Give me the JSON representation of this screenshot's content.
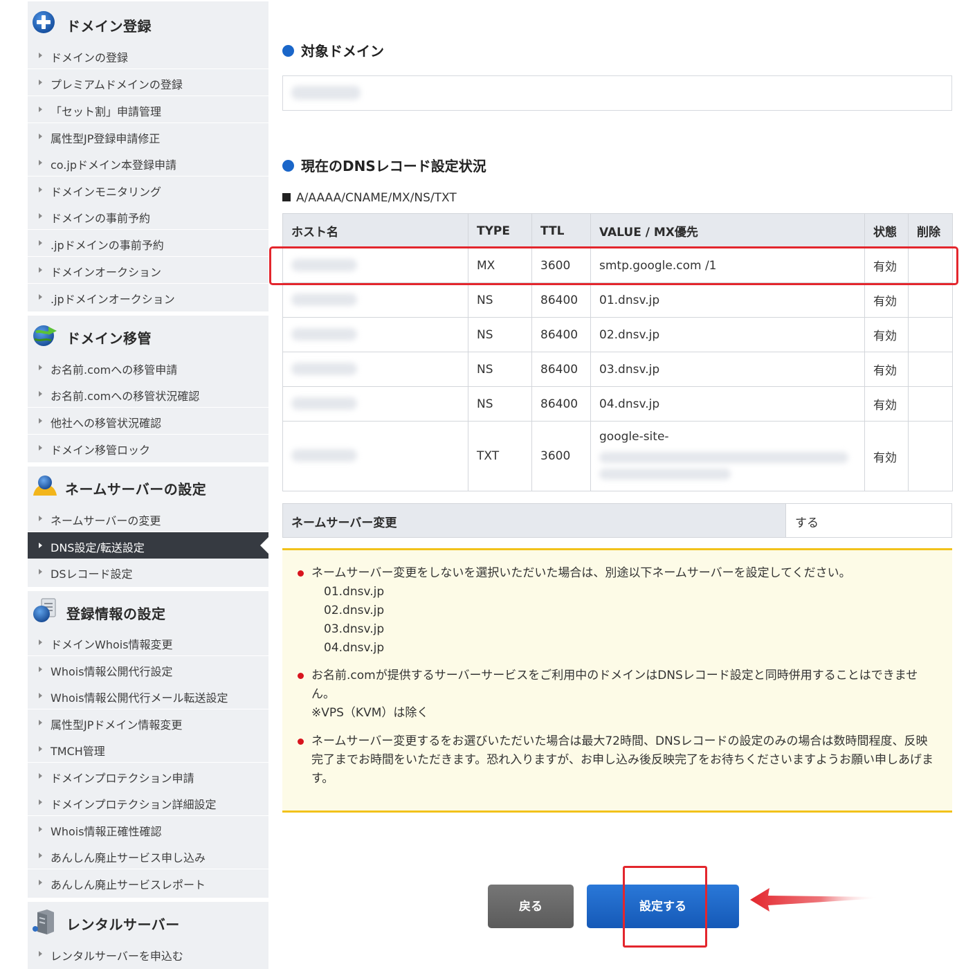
{
  "sidebar": {
    "sections": [
      {
        "title": "ドメイン登録",
        "icon": "plus-circle-icon",
        "items": [
          "ドメインの登録",
          "プレミアムドメインの登録",
          "「セット割」申請管理",
          "属性型JP登録申請修正",
          "co.jpドメイン本登録申請",
          "ドメインモニタリング",
          "ドメインの事前予約",
          ".jpドメインの事前予約",
          "ドメインオークション",
          ".jpドメインオークション"
        ]
      },
      {
        "title": "ドメイン移管",
        "icon": "transfer-globe-icon",
        "items": [
          "お名前.comへの移管申請",
          "お名前.comへの移管状況確認",
          "他社への移管状況確認",
          "ドメイン移管ロック"
        ]
      },
      {
        "title": "ネームサーバーの設定",
        "icon": "nameserver-person-icon",
        "items": [
          "ネームサーバーの変更",
          "DNS設定/転送設定",
          "DSレコード設定"
        ],
        "active": "DNS設定/転送設定"
      },
      {
        "title": "登録情報の設定",
        "icon": "registration-doc-icon",
        "items": [
          "ドメインWhois情報変更",
          "Whois情報公開代行設定",
          "Whois情報公開代行メール転送設定",
          "属性型JPドメイン情報変更",
          "TMCH管理",
          "ドメインプロテクション申請",
          "ドメインプロテクション詳細設定",
          "Whois情報正確性確認",
          "あんしん廃止サービス申し込み",
          "あんしん廃止サービスレポート"
        ]
      },
      {
        "title": "レンタルサーバー",
        "icon": "server-icon",
        "items": [
          "レンタルサーバーを申込む"
        ]
      }
    ]
  },
  "target_domain": {
    "heading": "対象ドメイン"
  },
  "dns_status": {
    "heading": "現在のDNSレコード設定状況",
    "record_types": "A/AAAA/CNAME/MX/NS/TXT",
    "columns": [
      "ホスト名",
      "TYPE",
      "TTL",
      "VALUE / MX優先",
      "状態",
      "削除"
    ],
    "rows": [
      {
        "type": "MX",
        "ttl": "3600",
        "value": "smtp.google.com /1",
        "status": "有効"
      },
      {
        "type": "NS",
        "ttl": "86400",
        "value": "01.dnsv.jp",
        "status": "有効"
      },
      {
        "type": "NS",
        "ttl": "86400",
        "value": "02.dnsv.jp",
        "status": "有効"
      },
      {
        "type": "NS",
        "ttl": "86400",
        "value": "03.dnsv.jp",
        "status": "有効"
      },
      {
        "type": "NS",
        "ttl": "86400",
        "value": "04.dnsv.jp",
        "status": "有効"
      },
      {
        "type": "TXT",
        "ttl": "3600",
        "value": "google-site-",
        "status": "有効"
      }
    ]
  },
  "nameserver_change": {
    "label": "ネームサーバー変更",
    "value": "する"
  },
  "notes": {
    "note1": "ネームサーバー変更をしないを選択いただいた場合は、別途以下ネームサーバーを設定してください。",
    "nameservers": [
      "01.dnsv.jp",
      "02.dnsv.jp",
      "03.dnsv.jp",
      "04.dnsv.jp"
    ],
    "note2": "お名前.comが提供するサーバーサービスをご利用中のドメインはDNSレコード設定と同時併用することはできません。",
    "note2_sub": "※VPS（KVM）は除く",
    "note3": "ネームサーバー変更するをお選びいただいた場合は最大72時間、DNSレコードの設定のみの場合は数時間程度、反映完了までお時間をいただきます。恐れ入りますが、お申し込み後反映完了をお待ちくださいますようお願い申しあげます。"
  },
  "buttons": {
    "back": "戻る",
    "submit": "設定する"
  },
  "colors": {
    "accent_blue": "#1a66c9",
    "highlight_red": "#e3262d",
    "notice_border": "#f2c21b",
    "sidebar_active": "#363a41"
  }
}
